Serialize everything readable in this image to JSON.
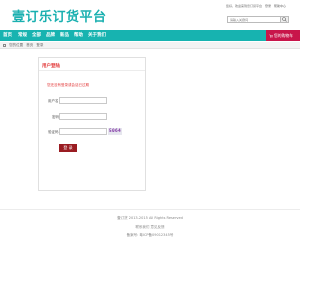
{
  "header": {
    "logo": "壹订乐订货平台",
    "top_links": [
      "您好，欢迎来到壹订货平台",
      "登录",
      "帮助中心"
    ]
  },
  "search": {
    "placeholder": "请输入关键词",
    "icon": "search-icon"
  },
  "nav": {
    "items": [
      "首页",
      "常规",
      "全部",
      "品牌",
      "新品",
      "帮助",
      "关于我们"
    ]
  },
  "cart": {
    "label": "您的购物车",
    "icon": "cart-icon"
  },
  "breadcrumb": {
    "items": [
      "您的位置",
      "首页",
      "登录"
    ]
  },
  "login_box": {
    "title": "用户登陆",
    "notice": "您还没有登录或会话已过期",
    "username_label": "用户名",
    "password_label": "密码",
    "captcha_label": "验证码",
    "captcha_value": "5064",
    "submit_label": "登 录"
  },
  "footer": {
    "copyright": "壹订货 2013-2015 All Rights Reserved",
    "links": "联系我们  意见反馈",
    "icp": "备案号: 粤ICP备09012345号"
  },
  "colors": {
    "brand": "#17b3b0",
    "cart": "#c8154a",
    "accent_red": "#e23a3a",
    "button": "#9a1c22"
  }
}
